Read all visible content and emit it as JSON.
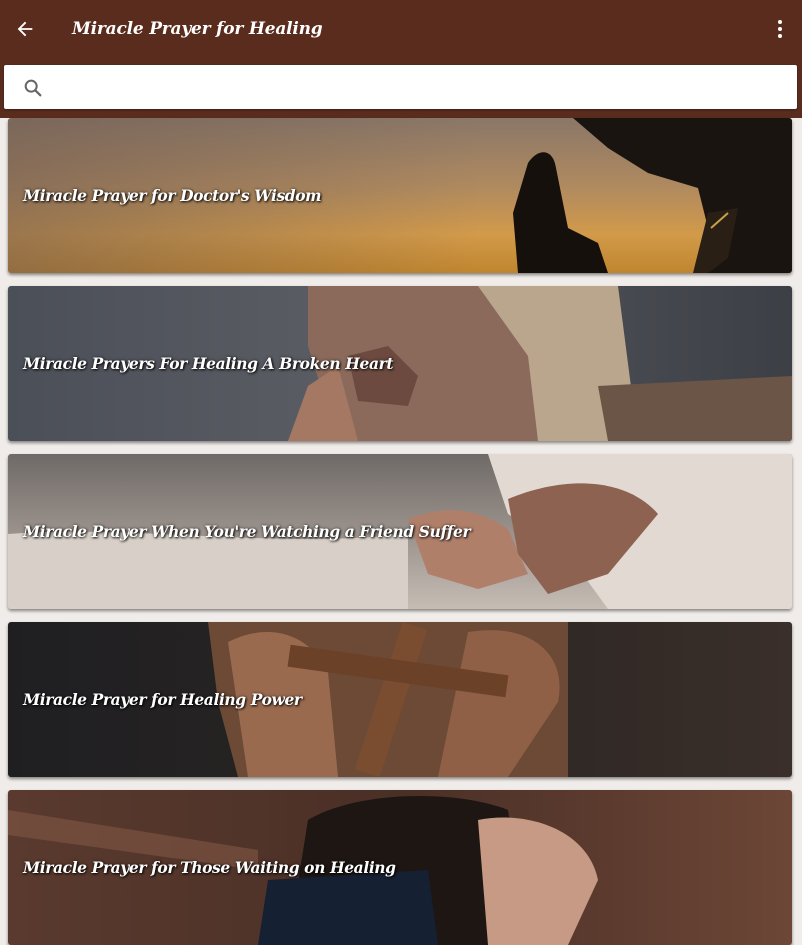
{
  "app": {
    "title": "Miracle Prayer for Healing",
    "back_icon": "arrow-left-icon",
    "menu_icon": "more-vertical-icon",
    "bar_color": "#5a2c1e"
  },
  "search": {
    "icon": "search-icon",
    "placeholder": "",
    "value": ""
  },
  "items": [
    {
      "label": "Miracle Prayer for Doctor's Wisdom",
      "image": "praying-silhouette-sunset"
    },
    {
      "label": "Miracle Prayers For Healing A Broken Heart",
      "image": "woman-praying-hands"
    },
    {
      "label": "Miracle Prayer When You're Watching a Friend Suffer",
      "image": "holding-hands-bedside"
    },
    {
      "label": "Miracle Prayer for Healing Power",
      "image": "hands-holding-wooden-cross"
    },
    {
      "label": "Miracle Prayer for Those Waiting on Healing",
      "image": "woman-bowed-in-prayer"
    }
  ]
}
